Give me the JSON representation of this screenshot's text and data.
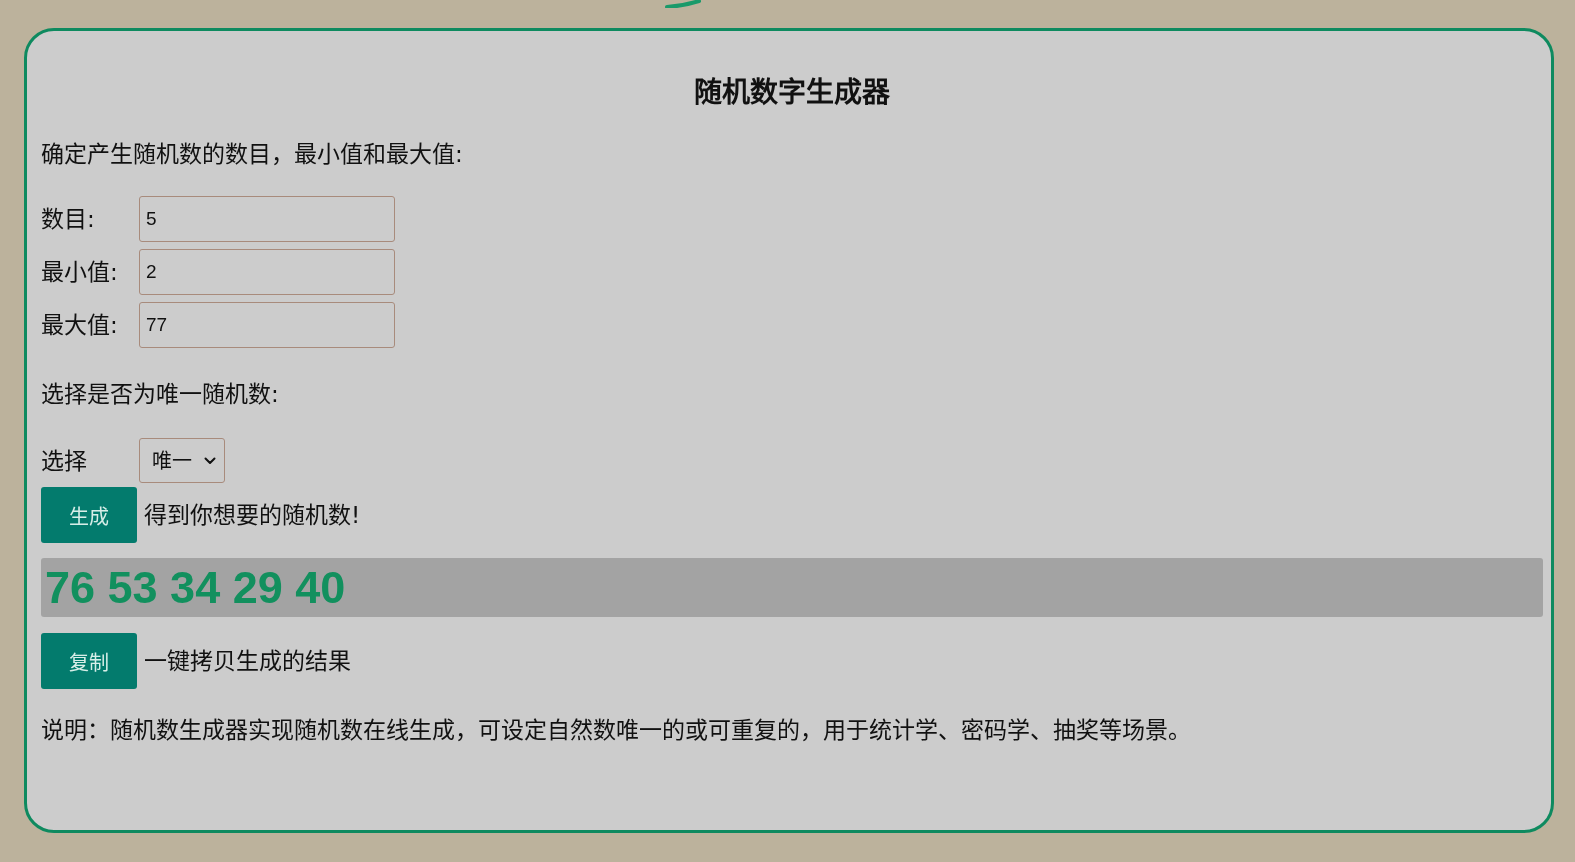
{
  "title": "随机数字生成器",
  "intro": "确定产生随机数的数目，最小值和最大值:",
  "fields": [
    {
      "label": "数目:",
      "value": "5"
    },
    {
      "label": "最小值:",
      "value": "2"
    },
    {
      "label": "最大值:",
      "value": "77"
    }
  ],
  "unique_prompt": "选择是否为唯一随机数:",
  "choice": {
    "label": "选择",
    "value": "唯一"
  },
  "generate": {
    "button": "生成",
    "hint": "得到你想要的随机数!"
  },
  "result": "76 53 34 29 40",
  "copy": {
    "button": "复制",
    "hint": "一键拷贝生成的结果"
  },
  "note": "说明：随机数生成器实现随机数在线生成，可设定自然数唯一的或可重复的，用于统计学、密码学、抽奖等场景。"
}
